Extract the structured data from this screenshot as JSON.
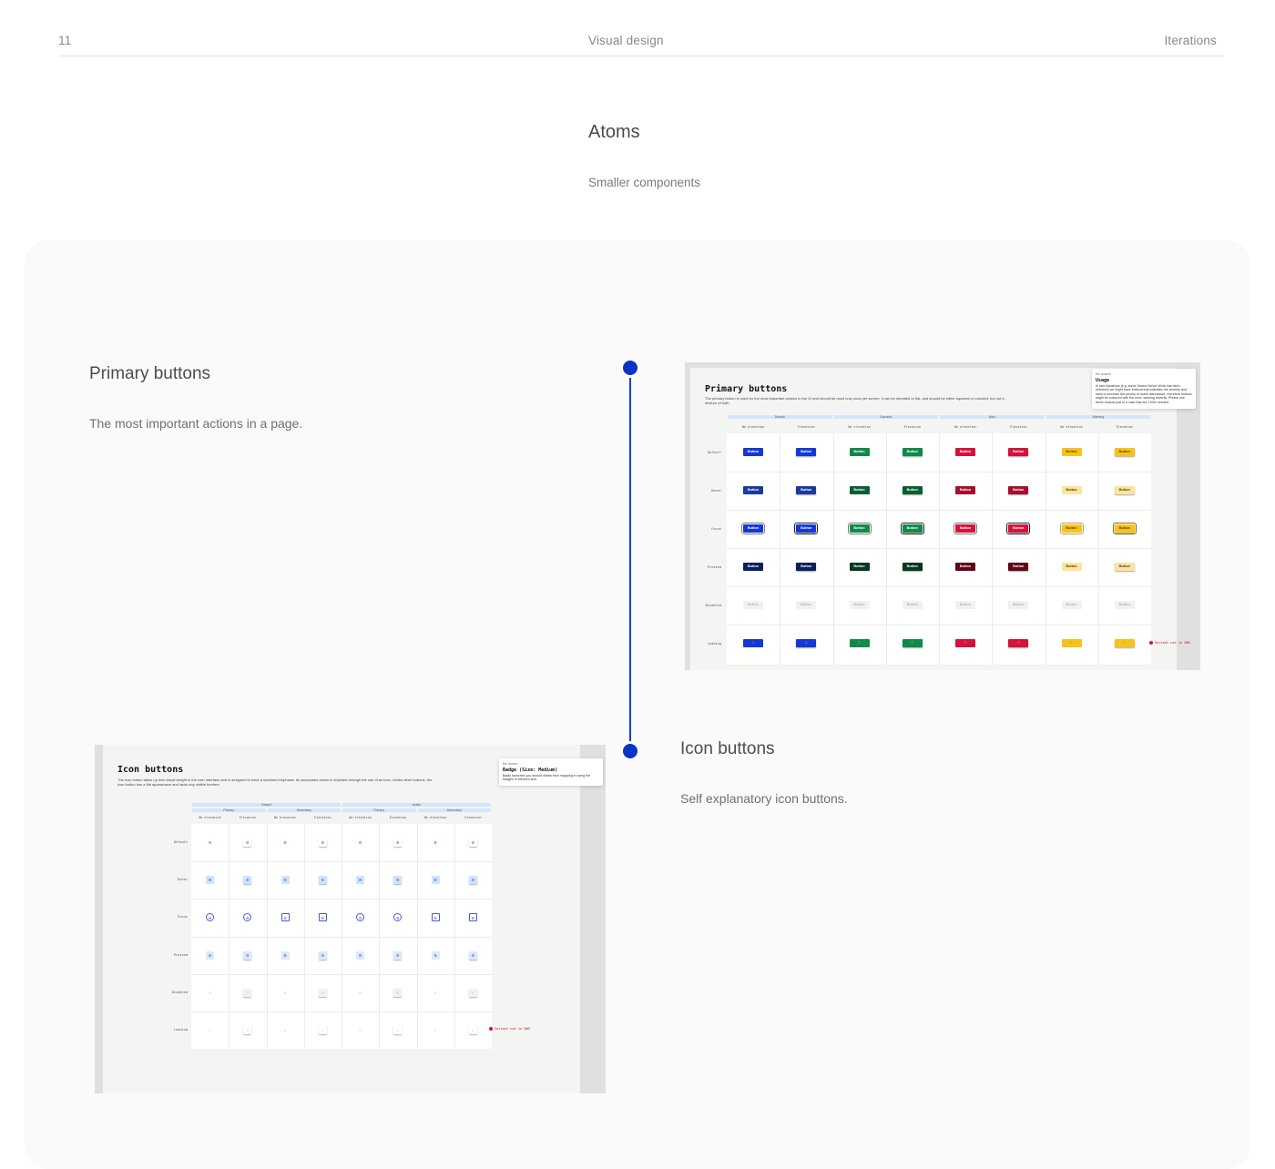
{
  "header": {
    "page_number": "11",
    "section": "Visual design",
    "chapter": "Iterations"
  },
  "atoms": {
    "title": "Atoms",
    "subtitle": "Smaller components"
  },
  "primary": {
    "title": "Primary buttons",
    "description": "The most important actions in a page.",
    "mock": {
      "title": "Primary buttons",
      "description": "The primary button is used for the most important actions in the UI and should be used only once per screen. It can be elevated or flat, and should be either squared or rounded, but not a mixture of both.",
      "note_tag": "Be aware",
      "note_title": "Usage",
      "note_body": "In rare situations (e.g. some Search Never Work has been selected) we might have buttons that indicates the severity and want to increase the priority of users attendance, therefore buttons might be coloured with the error, warning severity. Please use these buttons just in a case that are 100% needed.",
      "groups": [
        "Default",
        "Success",
        "Alert",
        "Warning"
      ],
      "columns": [
        "No elevation",
        "Elevation",
        "No elevation",
        "Elevation",
        "No elevation",
        "Elevation",
        "No elevation",
        "Elevation"
      ],
      "rows": [
        "Default",
        "Hover",
        "Focus",
        "Pressed",
        "Disabled",
        "Loading"
      ],
      "button_label": "Button",
      "error_note": "Variant not in DNS",
      "colors": {
        "blue": "#1538d4",
        "green": "#0f8a4a",
        "red": "#d4133c",
        "yellow": "#f7c21b"
      }
    }
  },
  "icon": {
    "title": "Icon buttons",
    "description": "Self explanatory icon buttons.",
    "mock": {
      "title": "Icon buttons",
      "description": "The icon button takes up less visual weight in the user interface and is designed to have a subdued emphasis. Its associated action is depicted through the use of an icon. Unlike other buttons, the icon button has a flat appearance and lacks any visible borders.",
      "note_tag": "Be aware",
      "note_title": "Badge (Size: Medium)",
      "note_body": "Badly searches you should obtain from mapping in using the badges to Medium size.",
      "groups": [
        "Default",
        "Active"
      ],
      "sub_groups": [
        "Primary",
        "Secondary",
        "Primary",
        "Secondary"
      ],
      "columns": [
        "No elevation",
        "Elevation",
        "No elevation",
        "Elevation",
        "No elevation",
        "Elevation",
        "No elevation",
        "Elevation"
      ],
      "rows": [
        "Default",
        "Hover",
        "Focus",
        "Pressed",
        "Disabled",
        "Loading"
      ],
      "error_note": "Variant not in DNS",
      "icon_names": [
        "settings-icon",
        "spinner-icon"
      ]
    }
  }
}
